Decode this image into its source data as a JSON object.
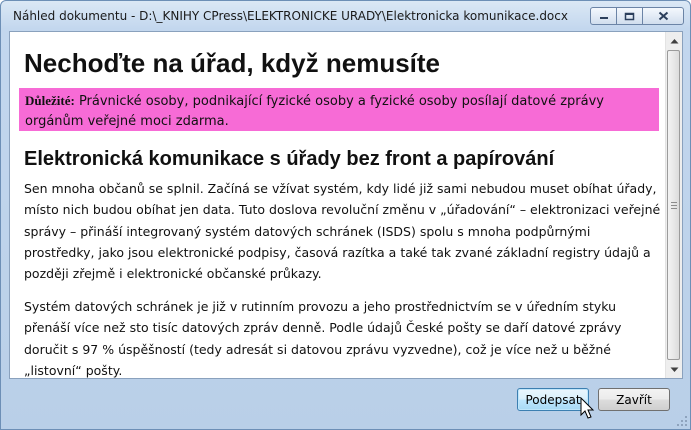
{
  "window": {
    "title": "Náhled dokumentu - D:\\_KNIHY CPress\\ELEKTRONICKE URADY\\Elektronicka komunikace.docx",
    "buttons": [
      "minimize-icon",
      "maximize-icon",
      "close-icon"
    ]
  },
  "document": {
    "heading": "Nechoďte na úřad, když nemusíte",
    "note_label": "Důležité:",
    "note_text": " Právnické osoby, podnikající fyzické osoby a fyzické osoby posílají datové zprávy orgánům veřejné moci zdarma.",
    "note_color": "#f76bd6",
    "subheading": "Elektronická komunikace s úřady bez front a papírování",
    "paragraphs": [
      "Sen mnoha občanů se splnil. Začíná se vžívat systém, kdy lidé již sami nebudou muset obíhat úřady, místo nich budou obíhat jen data. Tuto doslova revoluční změnu v „úřadování“ – elektronizaci veřejné správy – přináší integrovaný systém datových schránek (ISDS) spolu s mnoha podpůrnými prostředky, jako jsou elektronické podpisy, časová razítka a také tak zvané základní registry údajů a později zřejmě i elektronické občanské průkazy.",
      "Systém datových schránek je již v rutinním provozu a jeho prostřednictvím se v úředním styku přenáší více než sto tisíc datových zpráv denně. Podle údajů České pošty se daří datové zprávy doručit s 97 % úspěšností (tedy adresát si datovou zprávu vyzvedne), což je více než u běžné „listovní“ pošty."
    ]
  },
  "footer": {
    "sign_label": "Podepsat",
    "close_label": "Zavřít"
  }
}
